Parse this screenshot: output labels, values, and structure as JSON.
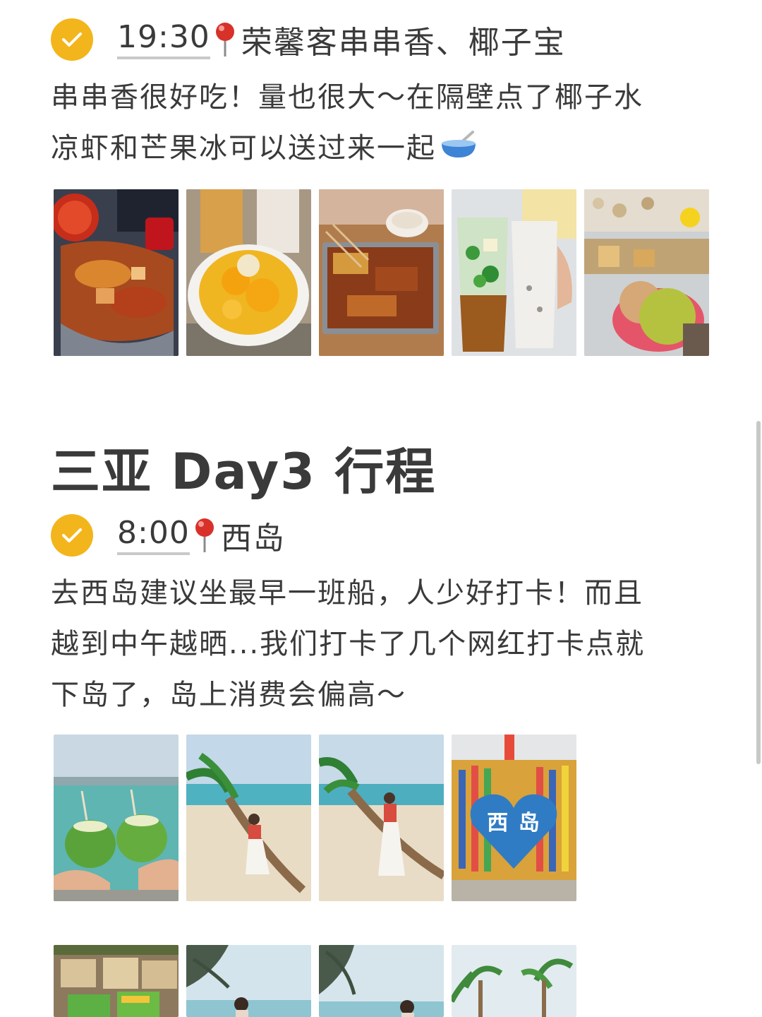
{
  "entry1": {
    "time": "19:30",
    "place": "荣馨客串串香、椰子宝",
    "desc_line1": "串串香很好吃！量也很大～在隔壁点了椰子水",
    "desc_line2": "凉虾和芒果冰可以送过来一起",
    "photos": [
      "chuanchuan-photo",
      "mango-ice-photo",
      "skewers-tray-photo",
      "coconut-drink-photo",
      "skewer-shop-photo"
    ]
  },
  "day_title": "三亚 Day3 行程",
  "entry2": {
    "time": "8:00",
    "place": "西岛",
    "desc_line1": "去西岛建议坐最早一班船，人少好打卡！而且",
    "desc_line2": "越到中午越晒...我们打卡了几个网红打卡点就",
    "desc_line3": "下岛了，岛上消费会偏高～",
    "photos": [
      "coconuts-photo",
      "palm-pose-photo",
      "palm-lean-photo",
      "heart-wall-photo"
    ],
    "heart_wall_text": "西 岛"
  },
  "row3": {
    "photos": [
      "snack-bags-photo",
      "beach-girl-photo",
      "beach-girl-2-photo",
      "palm-trees-photo"
    ]
  },
  "colors": {
    "check": "#f3b51c",
    "text": "#3a3a3a",
    "pin": "#d8312a"
  }
}
